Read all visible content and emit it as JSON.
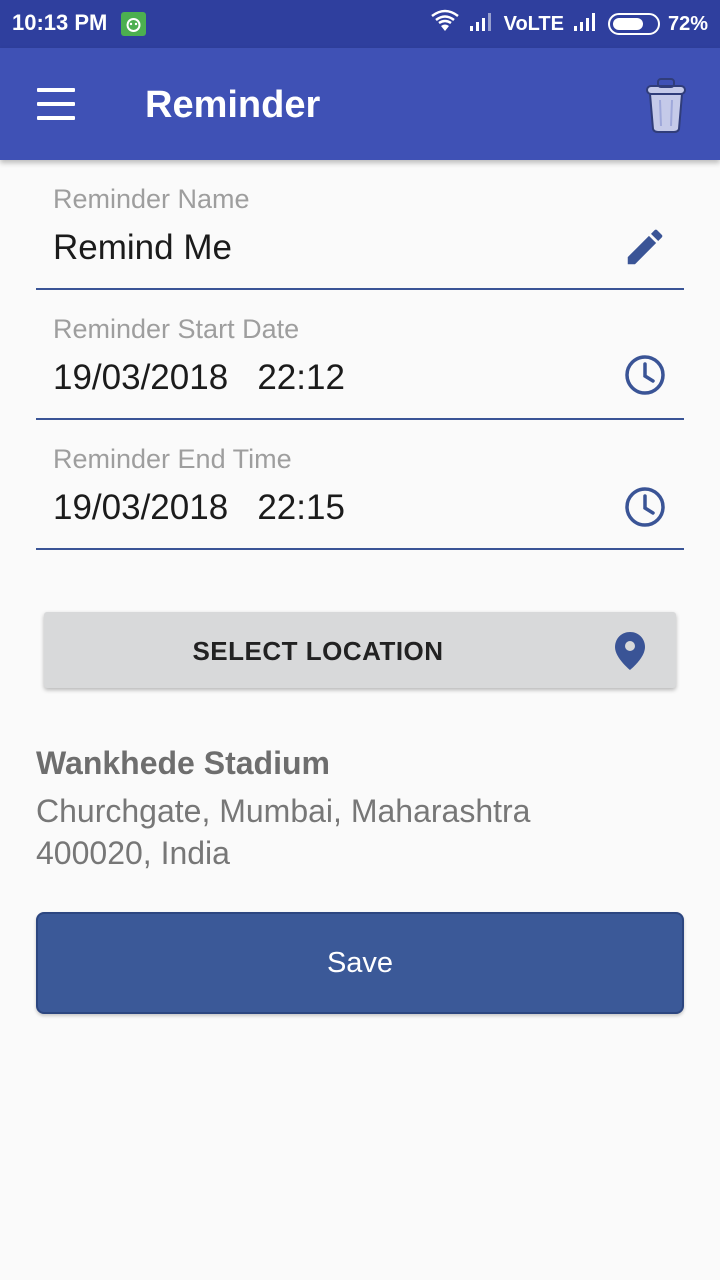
{
  "status_bar": {
    "time": "10:13 PM",
    "network": "VoLTE",
    "battery": "72%",
    "battery_level": 0.72,
    "icons": [
      "notification-app-icon",
      "wifi-icon",
      "signal-icon",
      "signal-icon",
      "battery-icon"
    ]
  },
  "app_bar": {
    "title": "Reminder",
    "menu_icon": "menu-icon",
    "delete_icon": "trash-icon",
    "color": "#3f51b5"
  },
  "form": {
    "name": {
      "label": "Reminder Name",
      "value": "Remind Me",
      "icon": "edit-pencil-icon"
    },
    "start": {
      "label": "Reminder Start Date",
      "value": "19/03/2018   22:12",
      "icon": "clock-icon"
    },
    "end": {
      "label": "Reminder End Time",
      "value": "19/03/2018   22:15",
      "icon": "clock-icon"
    }
  },
  "location_button": {
    "label": "SELECT LOCATION",
    "icon": "location-pin-icon"
  },
  "location": {
    "name": "Wankhede Stadium",
    "address": "Churchgate, Mumbai, Maharashtra 400020, India"
  },
  "save_button": {
    "label": "Save",
    "color": "#3b5998"
  }
}
